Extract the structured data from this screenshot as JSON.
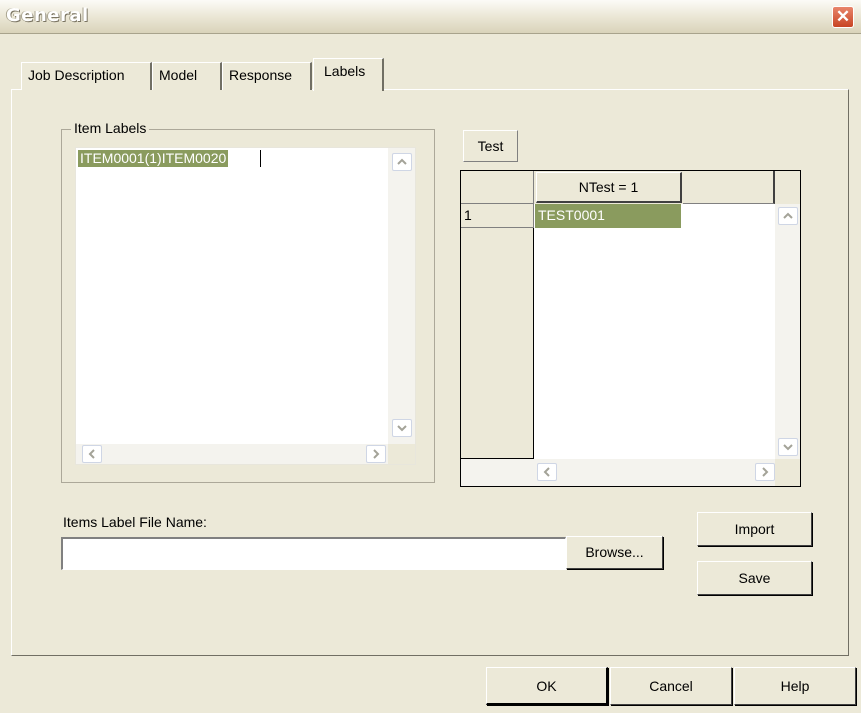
{
  "window": {
    "title": "General",
    "close_symbol": "✕"
  },
  "tabs": [
    {
      "label": "Job Description",
      "active": false
    },
    {
      "label": "Model",
      "active": false
    },
    {
      "label": "Response",
      "active": false
    },
    {
      "label": "Labels",
      "active": true
    }
  ],
  "item_labels": {
    "group_label": "Item Labels",
    "items": [
      "ITEM0001(1)ITEM0020"
    ]
  },
  "test": {
    "button_label": "Test",
    "grid": {
      "column_header": "NTest = 1",
      "rows": [
        {
          "row_number": "1",
          "value": "TEST0001"
        }
      ]
    }
  },
  "file": {
    "label": "Items Label File Name:",
    "value": "",
    "browse_label": "Browse...",
    "import_label": "Import",
    "save_label": "Save"
  },
  "footer": {
    "ok_label": "OK",
    "cancel_label": "Cancel",
    "help_label": "Help"
  },
  "colors": {
    "dialog_bg": "#ece9d8",
    "selection": "#8a9b5e",
    "close_button": "#d2502f"
  },
  "icons": {
    "close": "close-icon",
    "up": "scroll-up-arrow-icon",
    "down": "scroll-down-arrow-icon",
    "left": "scroll-left-arrow-icon",
    "right": "scroll-right-arrow-icon"
  }
}
